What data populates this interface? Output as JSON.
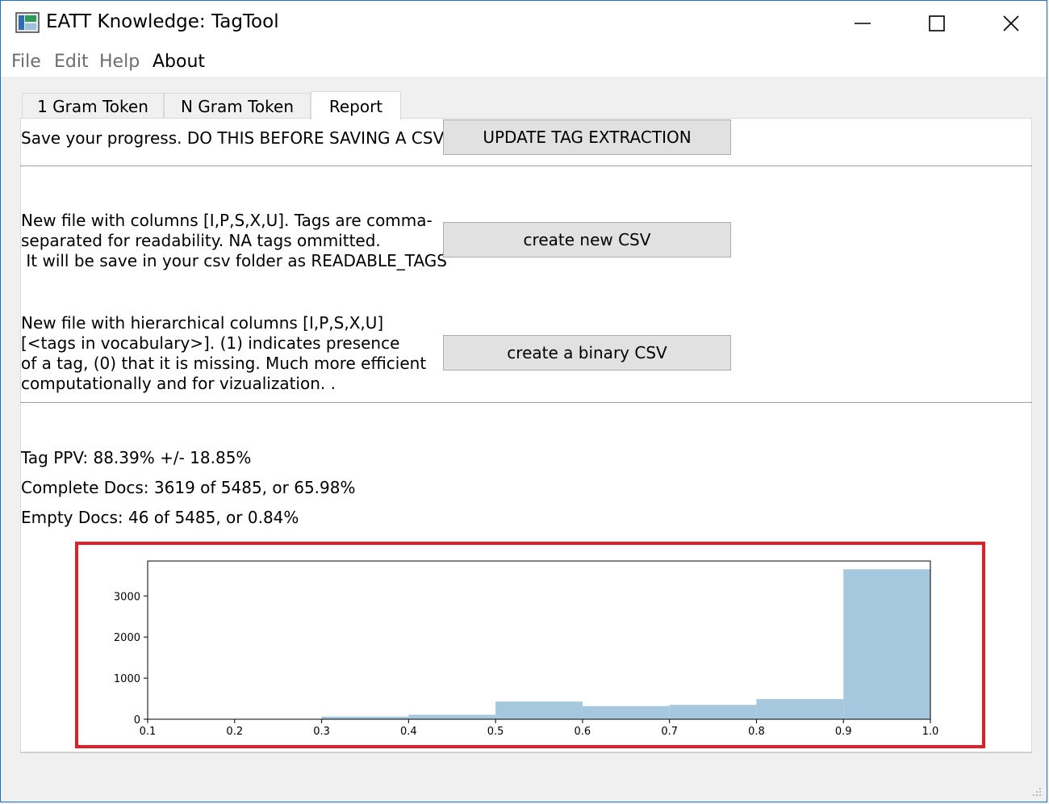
{
  "window": {
    "title": "EATT Knowledge:  TagTool"
  },
  "menu": {
    "file": "File",
    "edit": "Edit",
    "help": "Help",
    "about": "About"
  },
  "tabs": [
    {
      "label": "1 Gram Token"
    },
    {
      "label": "N Gram Token"
    },
    {
      "label": "Report"
    }
  ],
  "report": {
    "save_text": "Save your progress. DO THIS BEFORE SAVING A CSV!",
    "update_button": "UPDATE TAG EXTRACTION",
    "readable": {
      "lines": [
        "New file with columns [I,P,S,X,U]. Tags are comma-",
        "separated for readability. NA tags ommitted.",
        " It will be save in your csv folder as READABLE_TAGS"
      ],
      "button": "create new CSV"
    },
    "binary": {
      "lines": [
        "New file with hierarchical columns [I,P,S,X,U]",
        "[<tags in vocabulary>]. (1) indicates presence",
        "of a tag, (0) that it is missing. Much more efficient",
        "computationally and for vizualization. ."
      ],
      "button": "create a binary CSV"
    },
    "stats": {
      "ppv": "Tag PPV: 88.39% +/- 18.85%",
      "complete": "Complete Docs: 3619 of 5485, or 65.98%",
      "empty": "Empty Docs: 46 of 5485, or 0.84%"
    }
  },
  "chart_data": {
    "type": "bar",
    "bins": [
      [
        0.1,
        0.2
      ],
      [
        0.2,
        0.3
      ],
      [
        0.3,
        0.4
      ],
      [
        0.4,
        0.5
      ],
      [
        0.5,
        0.6
      ],
      [
        0.6,
        0.7
      ],
      [
        0.7,
        0.8
      ],
      [
        0.8,
        0.9
      ],
      [
        0.9,
        1.0
      ]
    ],
    "values": [
      0,
      0,
      65,
      110,
      430,
      320,
      350,
      490,
      3650
    ],
    "xlim": [
      0.1,
      1.0
    ],
    "ylim": [
      0,
      3850
    ],
    "xticks": [
      "0.1",
      "0.2",
      "0.3",
      "0.4",
      "0.5",
      "0.6",
      "0.7",
      "0.8",
      "0.9",
      "1.0"
    ],
    "yticks": [
      0,
      1000,
      2000,
      3000
    ],
    "bar_color": "#a6c8df",
    "highlight_color": "#e02028",
    "grid": false
  }
}
